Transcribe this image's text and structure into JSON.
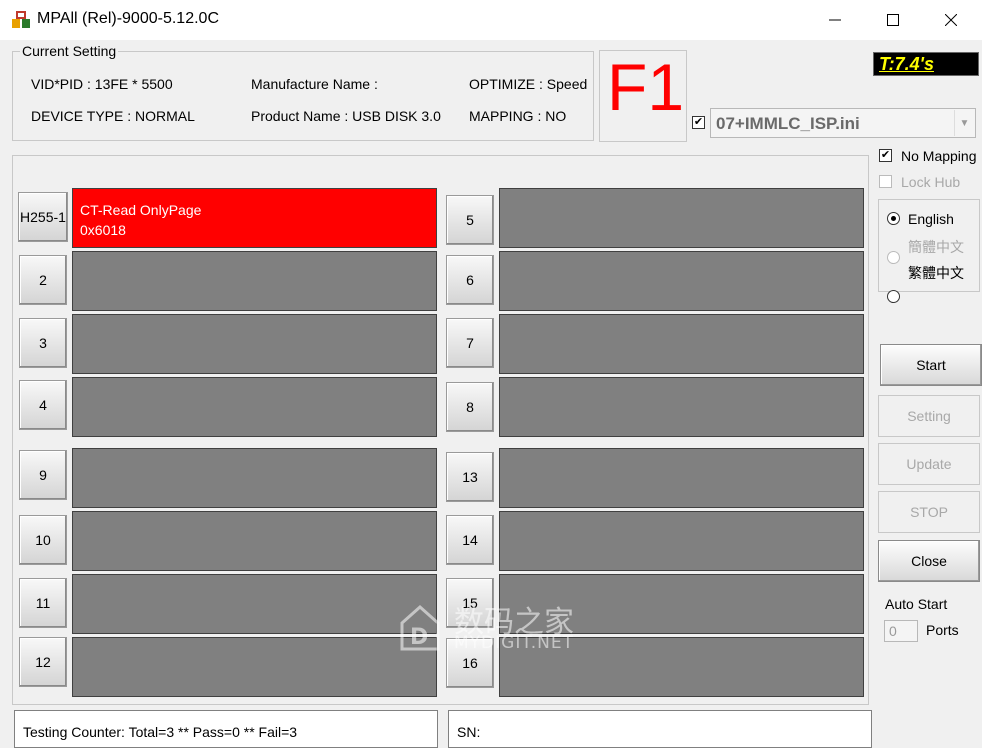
{
  "window": {
    "title": "MPAll (Rel)-9000-5.12.0C",
    "controls": [
      "—",
      "☐",
      "✕"
    ]
  },
  "current_setting": {
    "label": "Current Setting",
    "vid_pid": "VID*PID : 13FE * 5500",
    "device_type": "DEVICE TYPE : NORMAL",
    "manufacture_name": "Manufacture Name :",
    "product_name": "Product Name : USB DISK 3.0",
    "optimize": "OPTIMIZE : Speed",
    "mapping": "MAPPING : NO"
  },
  "f1_label": "F1",
  "timer": "T:7.4's",
  "ini_checkbox_checked": true,
  "ini_file": "07+IMMLC_ISP.ini",
  "ports": [
    {
      "button": "H255-1",
      "status_line1": "CT-Read OnlyPage",
      "status_line2": "0x6018",
      "state": "fail"
    },
    {
      "button": "2",
      "status_line1": "",
      "status_line2": "",
      "state": "idle"
    },
    {
      "button": "3",
      "status_line1": "",
      "status_line2": "",
      "state": "idle"
    },
    {
      "button": "4",
      "status_line1": "",
      "status_line2": "",
      "state": "idle"
    },
    {
      "button": "5",
      "status_line1": "",
      "status_line2": "",
      "state": "idle"
    },
    {
      "button": "6",
      "status_line1": "",
      "status_line2": "",
      "state": "idle"
    },
    {
      "button": "7",
      "status_line1": "",
      "status_line2": "",
      "state": "idle"
    },
    {
      "button": "8",
      "status_line1": "",
      "status_line2": "",
      "state": "idle"
    },
    {
      "button": "9",
      "status_line1": "",
      "status_line2": "",
      "state": "idle"
    },
    {
      "button": "10",
      "status_line1": "",
      "status_line2": "",
      "state": "idle"
    },
    {
      "button": "11",
      "status_line1": "",
      "status_line2": "",
      "state": "idle"
    },
    {
      "button": "12",
      "status_line1": "",
      "status_line2": "",
      "state": "idle"
    },
    {
      "button": "13",
      "status_line1": "",
      "status_line2": "",
      "state": "idle"
    },
    {
      "button": "14",
      "status_line1": "",
      "status_line2": "",
      "state": "idle"
    },
    {
      "button": "15",
      "status_line1": "",
      "status_line2": "",
      "state": "idle"
    },
    {
      "button": "16",
      "status_line1": "",
      "status_line2": "",
      "state": "idle"
    }
  ],
  "options": {
    "no_mapping": {
      "label": "No Mapping",
      "checked": true
    },
    "lock_hub": {
      "label": "Lock Hub",
      "checked": false,
      "enabled": false
    }
  },
  "language": {
    "options": [
      {
        "label": "English",
        "selected": true,
        "enabled": true
      },
      {
        "label": "簡體中文",
        "selected": false,
        "enabled": false
      },
      {
        "label": "繁體中文",
        "selected": false,
        "enabled": true
      }
    ]
  },
  "buttons": {
    "start": "Start",
    "setting": "Setting",
    "update": "Update",
    "stop": "STOP",
    "close": "Close"
  },
  "auto_start": {
    "label": "Auto Start",
    "value": "0",
    "unit": "Ports"
  },
  "status_bar": {
    "counter": "Testing Counter: Total=3 ** Pass=0 ** Fail=3",
    "sn": "SN:"
  },
  "watermark": {
    "text_cn": "数码之家",
    "text_en": "MYDIGIT.NET"
  },
  "colors": {
    "fail": "#ff0000",
    "idle": "#808080",
    "timer_bg": "#000000",
    "timer_fg": "#ffff00",
    "f1": "#ff0000"
  }
}
